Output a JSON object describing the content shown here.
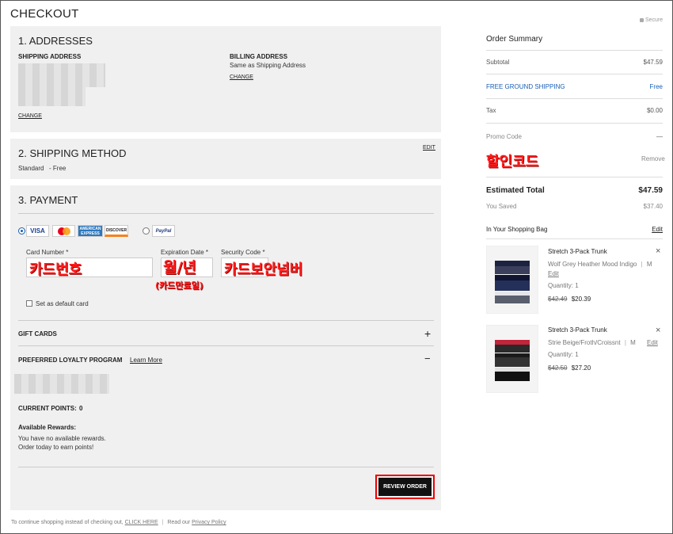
{
  "page": {
    "title": "CHECKOUT",
    "secure": "Secure"
  },
  "addresses": {
    "heading": "1. ADDRESSES",
    "shipping_label": "SHIPPING ADDRESS",
    "shipping_change": "CHANGE",
    "billing_label": "BILLING ADDRESS",
    "billing_value": "Same as Shipping Address",
    "billing_change": "CHANGE"
  },
  "shipping": {
    "heading": "2. SHIPPING METHOD",
    "edit": "EDIT",
    "method": "Standard",
    "price": "- Free"
  },
  "payment": {
    "heading": "3. PAYMENT",
    "card_options": [
      "VISA",
      "MasterCard",
      "AMERICAN EXPRESS",
      "DISCOVER"
    ],
    "paypal": "PayPal",
    "card_number_label": "Card Number *",
    "card_number_value": "카드번호",
    "expiration_label": "Expiration Date *",
    "expiration_value": "월/년",
    "expiration_note": "(카드만료일)",
    "security_label": "Security Code *",
    "security_value": "카드보안넘버",
    "default_card": "Set as default card",
    "gift_cards": "GIFT CARDS",
    "loyalty": "PREFERRED LOYALTY PROGRAM",
    "learn_more": "Learn More",
    "current_points": "CURRENT POINTS:",
    "points_value": "0",
    "rewards_heading": "Available Rewards:",
    "rewards_line1": "You have no available rewards.",
    "rewards_line2": "Order today to earn points!",
    "review_order": "REVIEW ORDER"
  },
  "footer": {
    "continue_text": "To continue shopping instead of checking out,",
    "click_here": "CLICK HERE",
    "read_our": "Read our",
    "privacy": "Privacy Policy"
  },
  "summary": {
    "heading": "Order Summary",
    "subtotal_label": "Subtotal",
    "subtotal_value": "$47.59",
    "shipping_label": "FREE GROUND SHIPPING",
    "shipping_value": "Free",
    "tax_label": "Tax",
    "tax_value": "$0.00",
    "promo_label": "Promo Code",
    "promo_toggle": "—",
    "promo_value": "할인코드",
    "promo_remove": "Remove",
    "total_label": "Estimated Total",
    "total_value": "$47.59",
    "saved_label": "You Saved",
    "saved_value": "$37.40",
    "bag_label": "In Your Shopping Bag",
    "bag_edit": "Edit",
    "items": [
      {
        "name": "Stretch 3-Pack Trunk",
        "color": "Wolf Grey Heather Mood Indigo",
        "size": "M",
        "edit": "Edit",
        "quantity": "Quantity: 1",
        "old_price": "$42.49",
        "price": "$20.39"
      },
      {
        "name": "Stretch 3-Pack Trunk",
        "color": "Strie Beige/Froth/Croissnt",
        "size": "M",
        "edit": "Edit",
        "quantity": "Quantity: 1",
        "old_price": "$42.50",
        "price": "$27.20"
      }
    ]
  },
  "colors": {
    "accent_blue": "#1a5fb4",
    "annotation_red": "#ff1e1e",
    "panel_bg": "#f0f0f0"
  }
}
